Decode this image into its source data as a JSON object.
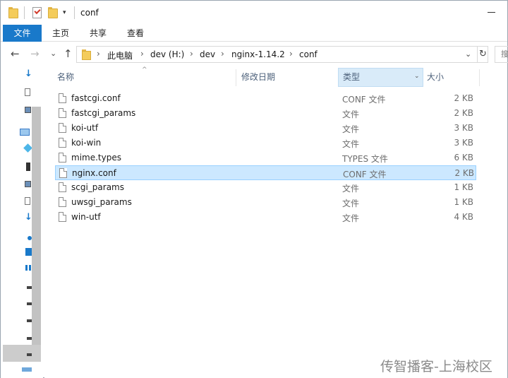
{
  "window": {
    "title": "conf"
  },
  "quick_access": {
    "customize_glyph": "▾"
  },
  "ribbon": {
    "tabs": [
      "文件",
      "主页",
      "共享",
      "查看"
    ]
  },
  "navigation": {
    "back_glyph": "←",
    "forward_glyph": "→",
    "recent_glyph": "⌄",
    "up_glyph": "↑"
  },
  "address_bar": {
    "separator": "›",
    "crumbs": [
      "此电脑",
      "dev (H:)",
      "dev",
      "nginx-1.14.2",
      "conf"
    ],
    "dropdown_glyph": "⌄",
    "refresh_glyph": "↻"
  },
  "search": {
    "placeholder": "搜"
  },
  "file_list": {
    "sort_indicator": "^",
    "columns": {
      "name": "名称",
      "modified": "修改日期",
      "type": "类型",
      "size": "大小"
    },
    "type_column_dropdown_glyph": "⌄",
    "files": [
      {
        "name": "fastcgi.conf",
        "type": "CONF 文件",
        "size": "2 KB",
        "selected": false
      },
      {
        "name": "fastcgi_params",
        "type": "文件",
        "size": "2 KB",
        "selected": false
      },
      {
        "name": "koi-utf",
        "type": "文件",
        "size": "3 KB",
        "selected": false
      },
      {
        "name": "koi-win",
        "type": "文件",
        "size": "3 KB",
        "selected": false
      },
      {
        "name": "mime.types",
        "type": "TYPES 文件",
        "size": "6 KB",
        "selected": false
      },
      {
        "name": "nginx.conf",
        "type": "CONF 文件",
        "size": "2 KB",
        "selected": true
      },
      {
        "name": "scgi_params",
        "type": "文件",
        "size": "1 KB",
        "selected": false
      },
      {
        "name": "uwsgi_params",
        "type": "文件",
        "size": "1 KB",
        "selected": false
      },
      {
        "name": "win-utf",
        "type": "文件",
        "size": "4 KB",
        "selected": false
      }
    ]
  },
  "watermark": "传智播客-上海校区",
  "colors": {
    "accent": "#1979ca",
    "selection_bg": "#cce8ff",
    "selection_border": "#99d1ff",
    "header_text": "#4c607a"
  }
}
